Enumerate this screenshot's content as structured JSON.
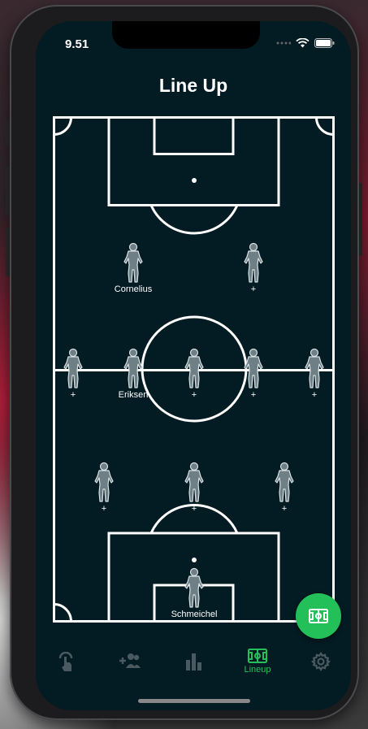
{
  "status": {
    "time": "9.51"
  },
  "header": {
    "title": "Line Up"
  },
  "players": [
    {
      "label": "Cornelius"
    },
    {
      "label": "+"
    },
    {
      "label": "+"
    },
    {
      "label": "Eriksen"
    },
    {
      "label": "+"
    },
    {
      "label": "+"
    },
    {
      "label": "+"
    },
    {
      "label": "+"
    },
    {
      "label": "+"
    },
    {
      "label": "+"
    },
    {
      "label": "Schmeichel"
    }
  ],
  "tabbar": {
    "items": [
      {
        "icon": "tap-icon",
        "label": ""
      },
      {
        "icon": "add-team-icon",
        "label": ""
      },
      {
        "icon": "stats-icon",
        "label": ""
      },
      {
        "icon": "pitch-icon",
        "label": "Lineup"
      },
      {
        "icon": "gear-icon",
        "label": ""
      }
    ],
    "active_color": "#23c05a",
    "inactive_color": "#4a5a60"
  },
  "fab": {
    "icon": "pitch-icon",
    "color": "#23c05a"
  },
  "colors": {
    "background": "#031b22",
    "pitch_lines": "#ffffff"
  }
}
